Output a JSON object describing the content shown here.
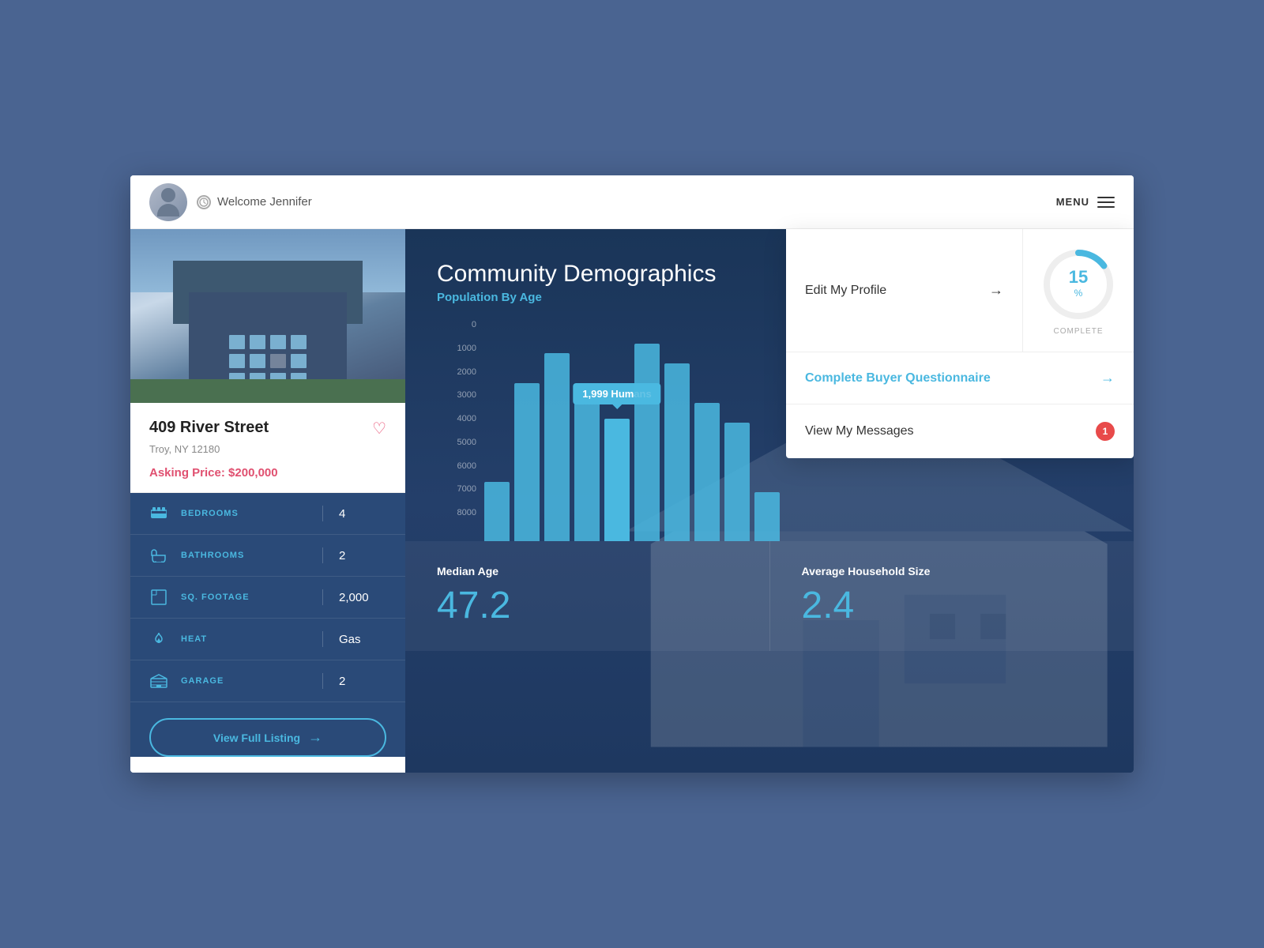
{
  "header": {
    "welcome_text": "Welcome Jennifer",
    "menu_label": "MENU"
  },
  "property": {
    "name": "409 River Street",
    "address": "Troy, NY 12180",
    "asking_price_label": "Asking Price:",
    "asking_price": "$200,000",
    "details": [
      {
        "icon": "bed-icon",
        "label": "BEDROOMS",
        "value": "4"
      },
      {
        "icon": "bath-icon",
        "label": "BATHROOMS",
        "value": "2"
      },
      {
        "icon": "sqft-icon",
        "label": "SQ. FOOTAGE",
        "value": "2,000"
      },
      {
        "icon": "heat-icon",
        "label": "HEAT",
        "value": "Gas"
      },
      {
        "icon": "garage-icon",
        "label": "GARAGE",
        "value": "2"
      }
    ],
    "view_listing_btn": "View Full Listing"
  },
  "chart": {
    "title": "Community Demographics",
    "subtitle": "Population By Age",
    "y_labels": [
      "0",
      "1000",
      "2000",
      "3000",
      "4000",
      "5000",
      "6000",
      "7000",
      "8000"
    ],
    "bars": [
      {
        "height_pct": 30,
        "highlighted": false
      },
      {
        "height_pct": 80,
        "highlighted": false
      },
      {
        "height_pct": 95,
        "highlighted": false
      },
      {
        "height_pct": 85,
        "highlighted": false
      },
      {
        "height_pct": 75,
        "highlighted": true,
        "tooltip": "1,999 Humans"
      },
      {
        "height_pct": 100,
        "highlighted": false
      },
      {
        "height_pct": 90,
        "highlighted": false
      },
      {
        "height_pct": 70,
        "highlighted": false
      },
      {
        "height_pct": 60,
        "highlighted": false
      },
      {
        "height_pct": 25,
        "highlighted": false
      }
    ],
    "stats": [
      {
        "label": "Median Age",
        "value": "47.2"
      },
      {
        "label": "Average Household Size",
        "value": "2.4"
      }
    ]
  },
  "dropdown": {
    "items": [
      {
        "text": "Edit My Profile",
        "arrow": "→",
        "blue": false,
        "badge": null
      },
      {
        "text": "Complete Buyer Questionnaire",
        "arrow": "→",
        "blue": true,
        "badge": null
      },
      {
        "text": "View My Messages",
        "arrow": null,
        "blue": false,
        "badge": "1"
      }
    ],
    "progress": {
      "percent": 15,
      "label": "COMPLETE"
    }
  }
}
